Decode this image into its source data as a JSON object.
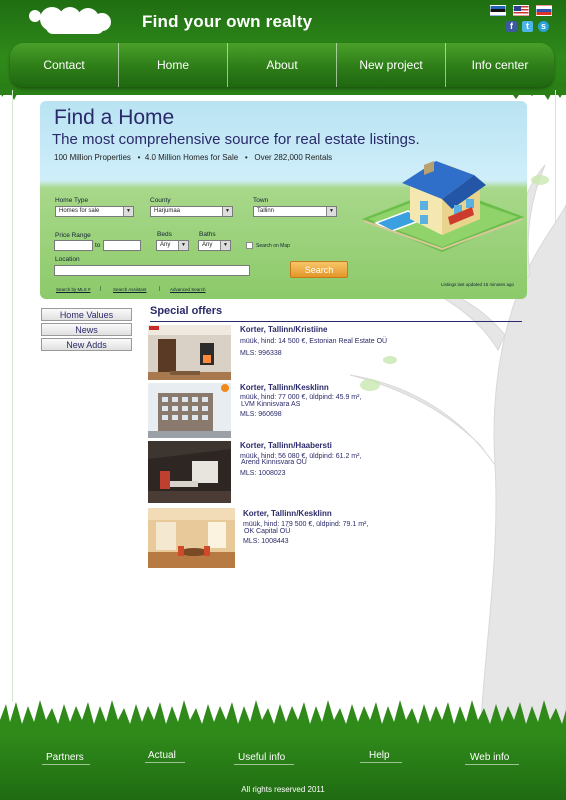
{
  "site": {
    "title": "Find your own realty",
    "languages": [
      "ee",
      "us",
      "ru"
    ],
    "socials": [
      "facebook-icon",
      "twitter-icon",
      "skype-icon"
    ]
  },
  "nav": [
    "Contact",
    "Home",
    "About",
    "New project",
    "Info center"
  ],
  "hero": {
    "title": "Find a Home",
    "subtitle": "The most comprehensive source for real estate listings.",
    "stats": "100 Million Properties   •  4.0 Million Homes for Sale   •   Over 282,000 Rentals",
    "fields": {
      "home_type_label": "Home Type",
      "home_type_value": "Homes for sale",
      "county_label": "County",
      "county_value": "Harjumaa",
      "town_label": "Town",
      "town_value": "Tallinn",
      "price_range_label": "Price Range",
      "to_label": "to",
      "beds_label": "Beds",
      "beds_value": "Any",
      "baths_label": "Baths",
      "baths_value": "Any",
      "search_on_map_label": "Search on Map",
      "location_label": "Location"
    },
    "search_button": "Search",
    "links": [
      "Search by MLS #",
      "Search Assistant",
      "Advanced Search"
    ],
    "updated": "Listings last updated 15 minutes ago"
  },
  "side_menu": [
    "Home Values",
    "News",
    "New Adds"
  ],
  "offers": {
    "heading": "Special offers",
    "items": [
      {
        "title": "Korter, Tallinn/Kristiine",
        "line1": "müük, hind: 14 500 €, Estonian Real Estate OÜ",
        "line2": "",
        "mls": "MLS: 996338"
      },
      {
        "title": "Korter, Tallinn/Kesklinn",
        "line1": "müük, hind: 77 000 €, üldpind: 45.9 m²,",
        "line2": "LVM Kinnisvara AS",
        "mls": "MLS: 960698"
      },
      {
        "title": "Korter, Tallinn/Haabersti",
        "line1": "müük, hind: 56 080 €, üldpind: 61.2 m²,",
        "line2": "Arend Kinnisvara OÜ",
        "mls": "MLS: 1008023"
      },
      {
        "title": "Korter, Tallinn/Kesklinn",
        "line1": "müük, hind: 179 500 €, üldpind: 79.1 m²,",
        "line2": "OK Capital OÜ",
        "mls": "MLS: 1008443"
      }
    ]
  },
  "footer": {
    "links": [
      "Partners",
      "Actual",
      "Useful info",
      "Help",
      "Web info"
    ],
    "copyright": "All rights reserved 2011"
  }
}
